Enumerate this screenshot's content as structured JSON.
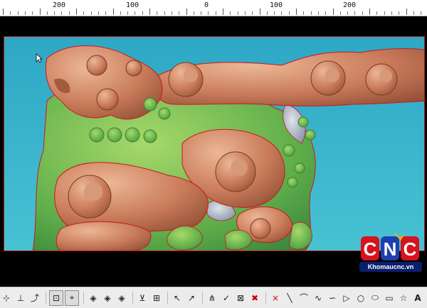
{
  "ruler": {
    "labels": [
      "200",
      "100",
      "0",
      "100",
      "200"
    ]
  },
  "toolbar": {
    "buttons": [
      "pipette-icon",
      "align-vertical-icon",
      "curve-edit-icon",
      "select-node-icon",
      "select-tool-icon",
      "mirror-diamond-icon",
      "mirror-diamond-2-icon",
      "mirror-diamond-3-icon",
      "align-bottom-icon",
      "align-center-icon",
      "select-arrow-icon",
      "select-arrow-x-icon",
      "node-edit-icon",
      "node-check-icon",
      "node-grid-icon",
      "delete-icon",
      "cross-icon",
      "line-icon",
      "arc-icon",
      "spline-icon",
      "bezier-icon",
      "polyline-icon",
      "circle-icon",
      "ellipse-icon",
      "rectangle-icon",
      "star-icon",
      "text-icon"
    ],
    "delete_symbol": "✖",
    "cross_symbol": "×",
    "text_symbol": "A"
  },
  "logo": {
    "letters": "CNC",
    "site": "Khomaucnc.vn"
  },
  "colors": {
    "background": "#3bb8cf",
    "wood": "#c97b5a",
    "green": "#5fb04b",
    "outline": "#d0141d"
  }
}
